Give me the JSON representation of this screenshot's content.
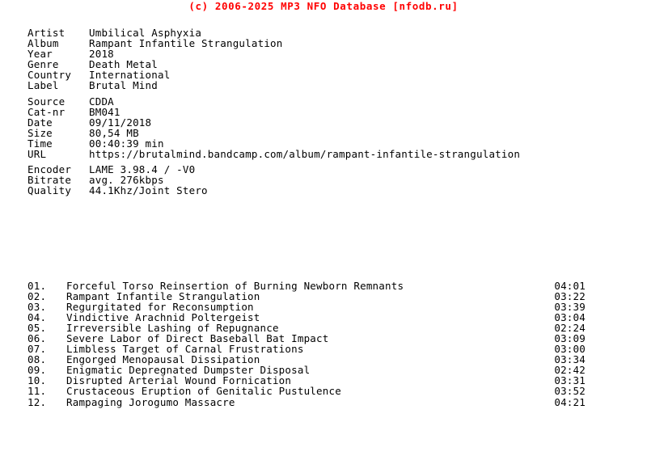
{
  "header": {
    "text": "(c) 2006-2025 MP3 NFO Database [nfodb.ru]",
    "color": "#ff0000"
  },
  "colors": {
    "background": "#ffffff",
    "body_text": "#000000",
    "header_text": "#ff0000"
  },
  "release_info": {
    "rows": [
      {
        "label": "Artist",
        "value": "Umbilical Asphyxia"
      },
      {
        "label": "Album",
        "value": "Rampant Infantile Strangulation"
      },
      {
        "label": "Year",
        "value": "2018"
      },
      {
        "label": "Genre",
        "value": "Death Metal"
      },
      {
        "label": "Country",
        "value": "International"
      },
      {
        "label": "Label",
        "value": "Brutal Mind"
      }
    ]
  },
  "source_info": {
    "rows": [
      {
        "label": "Source",
        "value": "CDDA"
      },
      {
        "label": "Cat-nr",
        "value": "BM041"
      },
      {
        "label": "Date",
        "value": "09/11/2018"
      },
      {
        "label": "Size",
        "value": "80,54 MB"
      },
      {
        "label": "Time",
        "value": "00:40:39 min"
      },
      {
        "label": "URL",
        "value": "https://brutalmind.bandcamp.com/album/rampant-infantile-strangulation"
      }
    ]
  },
  "audio_info": {
    "rows": [
      {
        "label": "Encoder",
        "value": "LAME 3.98.4 / -V0"
      },
      {
        "label": "Bitrate",
        "value": "avg. 276kbps"
      },
      {
        "label": "Quality",
        "value": "44.1Khz/Joint Stero"
      }
    ]
  },
  "tracklist": {
    "tracks": [
      {
        "num": "01.",
        "title": "Forceful Torso Reinsertion of Burning Newborn Remnants",
        "time": "04:01"
      },
      {
        "num": "02.",
        "title": "Rampant Infantile Strangulation",
        "time": "03:22"
      },
      {
        "num": "03.",
        "title": "Regurgitated for Reconsumption",
        "time": "03:39"
      },
      {
        "num": "04.",
        "title": "Vindictive Arachnid Poltergeist",
        "time": "03:04"
      },
      {
        "num": "05.",
        "title": "Irreversible Lashing of Repugnance",
        "time": "02:24"
      },
      {
        "num": "06.",
        "title": "Severe Labor of Direct Baseball Bat Impact",
        "time": "03:09"
      },
      {
        "num": "07.",
        "title": "Limbless Target of Carnal Frustrations",
        "time": "03:00"
      },
      {
        "num": "08.",
        "title": "Engorged Menopausal Dissipation",
        "time": "03:34"
      },
      {
        "num": "09.",
        "title": "Enigmatic Depregnated Dumpster Disposal",
        "time": "02:42"
      },
      {
        "num": "10.",
        "title": "Disrupted Arterial Wound Fornication",
        "time": "03:31"
      },
      {
        "num": "11.",
        "title": "Crustaceous Eruption of Genitalic Pustulence",
        "time": "03:52"
      },
      {
        "num": "12.",
        "title": "Rampaging Jorogumo Massacre",
        "time": "04:21"
      }
    ]
  }
}
